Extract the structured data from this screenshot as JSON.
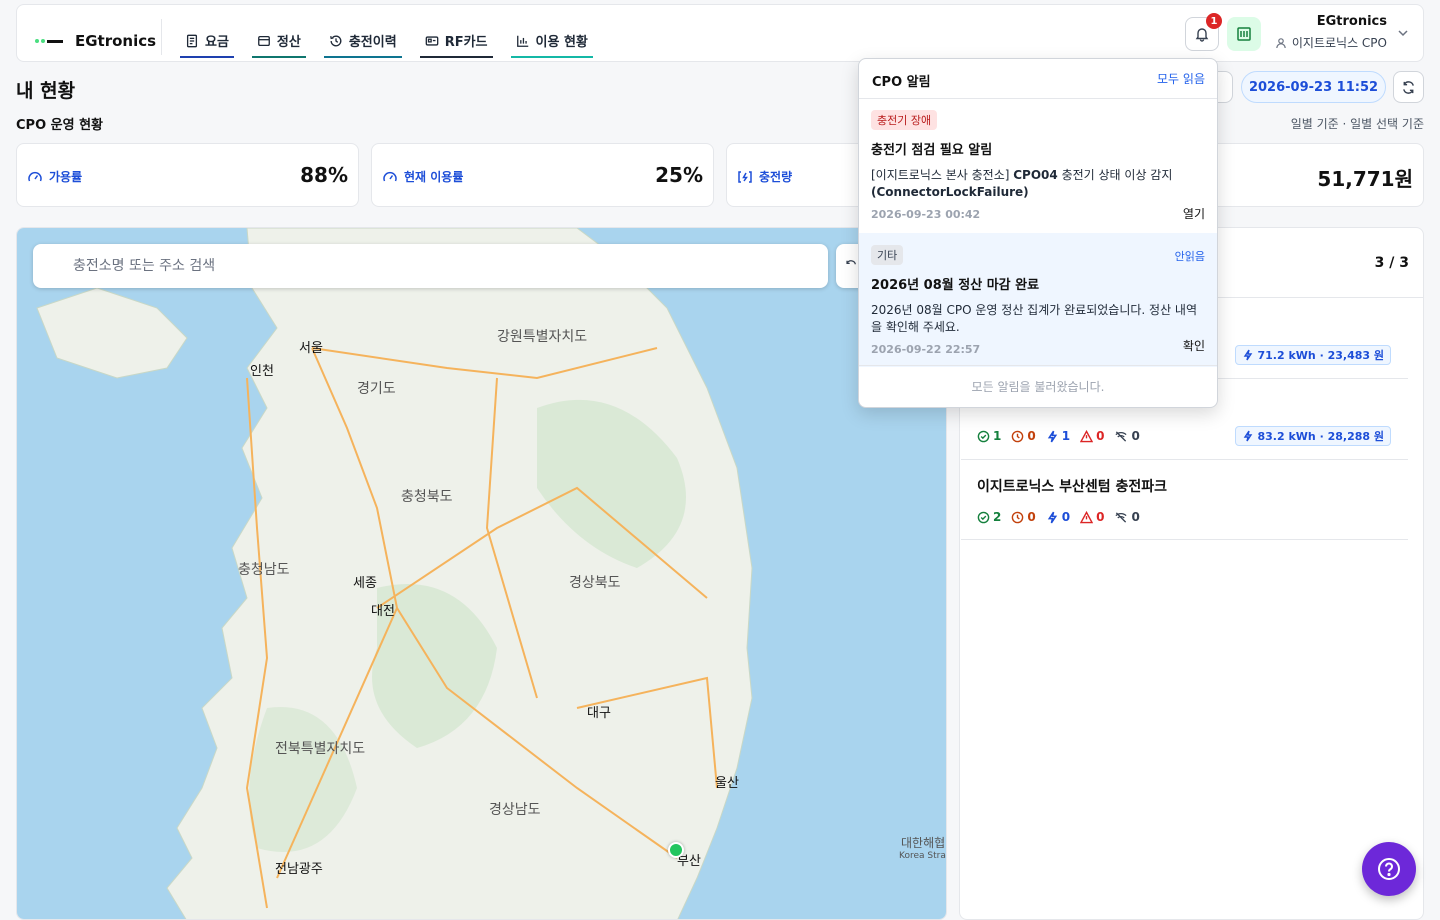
{
  "app": {
    "brand": "EGtronics"
  },
  "nav": [
    {
      "label": "요금",
      "icon": "receipt-icon"
    },
    {
      "label": "정산",
      "icon": "wallet-icon"
    },
    {
      "label": "충전이력",
      "icon": "history-icon"
    },
    {
      "label": "RF카드",
      "icon": "card-icon"
    },
    {
      "label": "이용 현황",
      "icon": "bar-chart-icon"
    }
  ],
  "header": {
    "notification_count": "1",
    "user_name": "EGtronics",
    "user_role": "이지트로닉스 CPO"
  },
  "page": {
    "title": "내 현황",
    "section_title": "CPO 운영 현황",
    "date": "2026-09-23 11:52",
    "basis": "일별 기준 · 일별 선택 기준"
  },
  "stats": [
    {
      "label": "가용률",
      "value": "88%"
    },
    {
      "label": "현재 이용률",
      "value": "25%"
    },
    {
      "label": "충전량",
      "value": ""
    },
    {
      "label": "",
      "value": "51,771원"
    }
  ],
  "map": {
    "search_placeholder": "충전소명 또는 주소 검색",
    "labels": [
      "서울",
      "인천",
      "강원특별자치도",
      "경기도",
      "충청북도",
      "충청남도",
      "세종",
      "대전",
      "경상북도",
      "전북특별자치도",
      "대구",
      "울산",
      "경상남도",
      "부산",
      "전남광주",
      "대한해협",
      "Korea Strait"
    ]
  },
  "stations_panel": {
    "count": "3 / 3",
    "stations": [
      {
        "name": "",
        "ok": "",
        "wait": "",
        "charge": "",
        "fault": "",
        "off": "",
        "energy": "71.2 kWh · 23,483 원"
      },
      {
        "name": "",
        "ok": "1",
        "wait": "0",
        "charge": "1",
        "fault": "0",
        "off": "0",
        "energy": "83.2 kWh · 28,288 원"
      },
      {
        "name": "이지트로닉스 부산센텀 충전파크",
        "ok": "2",
        "wait": "0",
        "charge": "0",
        "fault": "0",
        "off": "0",
        "energy": ""
      }
    ]
  },
  "notifications": {
    "title": "CPO 알림",
    "read_all": "모두 읽음",
    "items": [
      {
        "tag": "충전기 장애",
        "title": "충전기 점검 필요 알림",
        "body_prefix": "[이지트로닉스 본사 충전소] ",
        "body_strong": "CPO04",
        "body_suffix": " 충전기 상태 이상 감지",
        "body_code": "(ConnectorLockFailure)",
        "time": "2026-09-23 00:42",
        "action": "열기"
      },
      {
        "tag": "기타",
        "status": "안읽음",
        "title": "2026년 08월 정산 마감 완료",
        "body": "2026년 08월 CPO 운영 정산 집계가 완료되었습니다. 정산 내역을 확인해 주세요.",
        "time": "2026-09-22 22:57",
        "action": "확인"
      }
    ],
    "footer": "모든 알림을 불러왔습니다."
  }
}
